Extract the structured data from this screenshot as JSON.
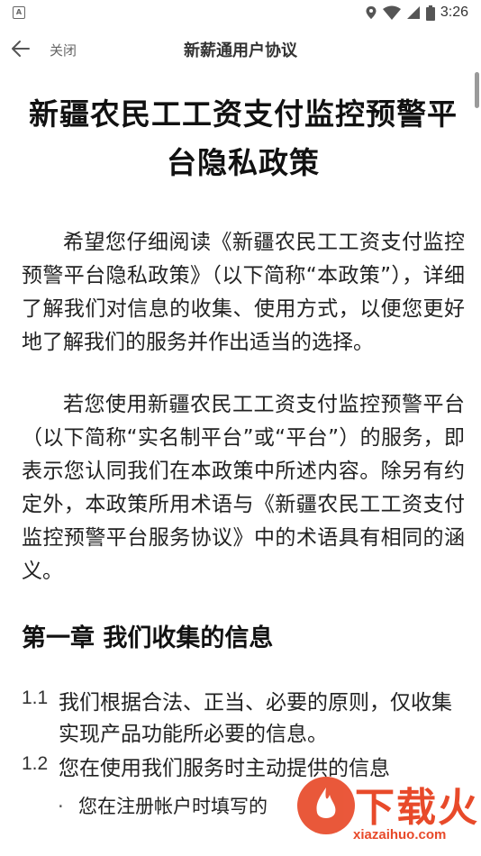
{
  "status_bar": {
    "notification_icon": "a-notification-icon",
    "notification_letter": "A",
    "icons": [
      "location-icon",
      "wifi-icon",
      "signal-icon",
      "battery-icon"
    ],
    "time": "3:26"
  },
  "app_bar": {
    "back_icon": "arrow-left-icon",
    "close_label": "关闭",
    "title": "新薪通用户协议"
  },
  "document": {
    "title": "新疆农民工工资支付监控预警平台隐私政策",
    "paragraphs": [
      "希望您仔细阅读《新疆农民工工资支付监控预警平台隐私政策》（以下简称“本政策”），详细了解我们对信息的收集、使用方式，以便您更好地了解我们的服务并作出适当的选择。",
      "若您使用新疆农民工工资支付监控预警平台（以下简称“实名制平台”或“平台”）的服务，即表示您认同我们在本政策中所述内容。除另有约定外，本政策所用术语与《新疆农民工工资支付监控预警平台服务协议》中的术语具有相同的涵义。"
    ],
    "chapter_title": "第一章 我们收集的信息",
    "items": [
      {
        "number": "1.1",
        "text": "我们根据合法、正当、必要的原则，仅收集实现产品功能所必要的信息。"
      },
      {
        "number": "1.2",
        "text": "您在使用我们服务时主动提供的信息"
      }
    ],
    "sub_items": [
      {
        "bullet": "·",
        "text": "您在注册帐户时填写的"
      }
    ]
  },
  "watermark": {
    "brand": "下载火",
    "site": "xiazaihuo.com"
  },
  "colors": {
    "text": "#222222",
    "muted": "#666666",
    "watermark": "#e84a2a"
  }
}
